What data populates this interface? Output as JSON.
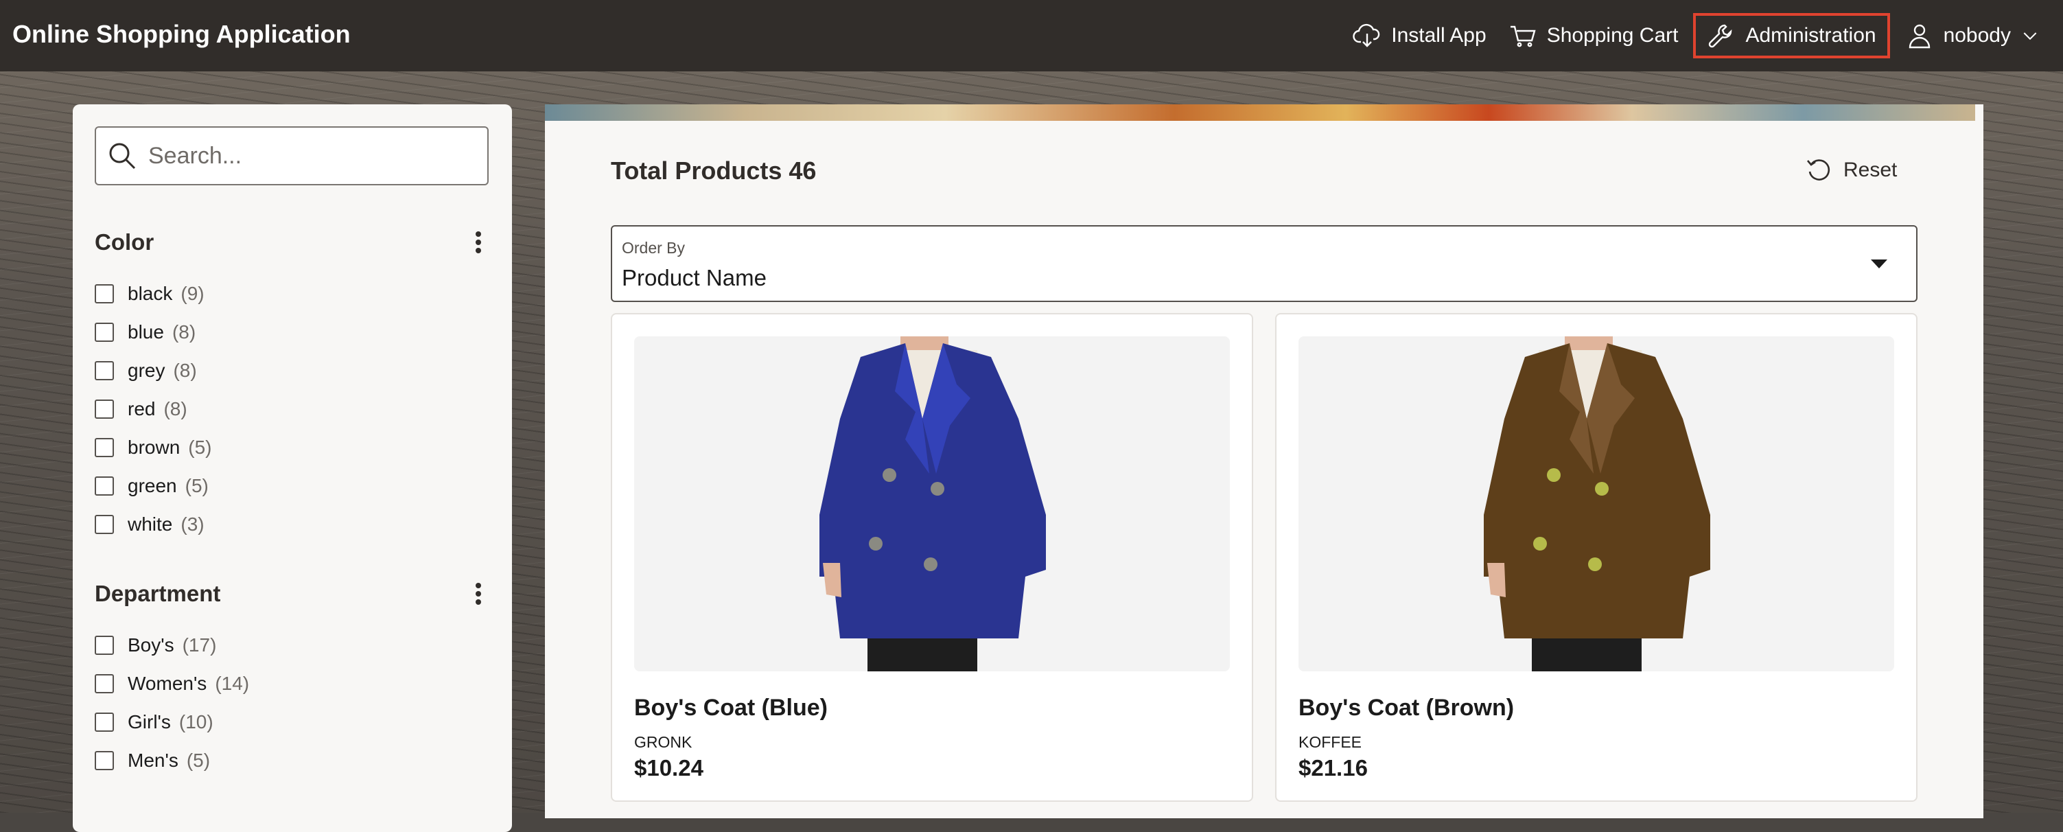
{
  "header": {
    "app_title": "Online Shopping Application",
    "nav": [
      {
        "label": "Install App",
        "icon": "cloud-download-icon"
      },
      {
        "label": "Shopping Cart",
        "icon": "cart-icon"
      },
      {
        "label": "Administration",
        "icon": "wrench-icon",
        "highlighted": true
      },
      {
        "label": "nobody",
        "icon": "user-icon"
      }
    ]
  },
  "sidebar": {
    "search_placeholder": "Search...",
    "facets": [
      {
        "title": "Color",
        "options": [
          {
            "label": "black",
            "count": "(9)"
          },
          {
            "label": "blue",
            "count": "(8)"
          },
          {
            "label": "grey",
            "count": "(8)"
          },
          {
            "label": "red",
            "count": "(8)"
          },
          {
            "label": "brown",
            "count": "(5)"
          },
          {
            "label": "green",
            "count": "(5)"
          },
          {
            "label": "white",
            "count": "(3)"
          }
        ]
      },
      {
        "title": "Department",
        "options": [
          {
            "label": "Boy's",
            "count": "(17)"
          },
          {
            "label": "Women's",
            "count": "(14)"
          },
          {
            "label": "Girl's",
            "count": "(10)"
          },
          {
            "label": "Men's",
            "count": "(5)"
          }
        ]
      }
    ]
  },
  "main": {
    "total_label": "Total Products",
    "total_count": "46",
    "reset_label": "Reset",
    "order_by": {
      "label": "Order By",
      "value": "Product Name"
    },
    "products": [
      {
        "name": "Boy's Coat (Blue)",
        "brand": "GRONK",
        "price": "$10.24",
        "coat_color": "#2a3491",
        "lapel_color": "#3342b8"
      },
      {
        "name": "Boy's Coat (Brown)",
        "brand": "KOFFEE",
        "price": "$21.16",
        "coat_color": "#5e3f1a",
        "lapel_color": "#7a5630"
      }
    ]
  },
  "colors": {
    "header_bg": "#312d2a",
    "highlight_border": "#e0432f",
    "panel_bg": "#f8f7f5"
  }
}
